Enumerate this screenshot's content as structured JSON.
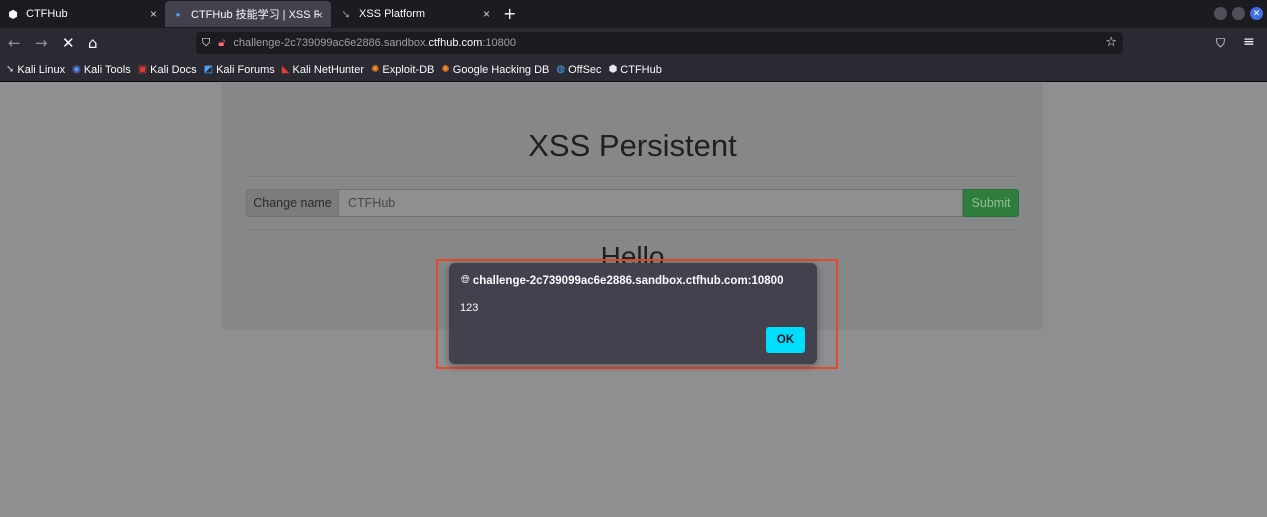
{
  "tabs": [
    {
      "title": "CTFHub",
      "icon": "ctfhub-icon",
      "close": "×"
    },
    {
      "title": "CTFHub 技能学习 | XSS Pe",
      "icon": "loading-icon",
      "close": "×"
    },
    {
      "title": "XSS Platform",
      "icon": "kali-icon",
      "close": "×"
    }
  ],
  "new_tab": "+",
  "nav": {
    "back": "←",
    "forward": "→",
    "stop": "✕",
    "home": "⌂",
    "url_prefix": "challenge-2c739099ac6e2886.sandbox.",
    "url_host": "ctfhub.com",
    "url_suffix": ":10800"
  },
  "bookmarks": [
    {
      "label": "Kali Linux",
      "glyph": "➘",
      "color": "#cfcfd8"
    },
    {
      "label": "Kali Tools",
      "glyph": "◉",
      "color": "#5a8fff"
    },
    {
      "label": "Kali Docs",
      "glyph": "▣",
      "color": "#e53935"
    },
    {
      "label": "Kali Forums",
      "glyph": "◩",
      "color": "#4aa3ff"
    },
    {
      "label": "Kali NetHunter",
      "glyph": "◣",
      "color": "#e53935"
    },
    {
      "label": "Exploit-DB",
      "glyph": "✺",
      "color": "#ff8a2a"
    },
    {
      "label": "Google Hacking DB",
      "glyph": "✺",
      "color": "#ff8a2a"
    },
    {
      "label": "OffSec",
      "glyph": "◍",
      "color": "#4aa3ff"
    },
    {
      "label": "CTFHub",
      "glyph": "⬢",
      "color": "#e8e8ee"
    }
  ],
  "page": {
    "title": "XSS Persistent",
    "addon_label": "Change name",
    "input_value": "CTFHub",
    "submit_label": "Submit",
    "hello": "Hello"
  },
  "dialog": {
    "origin": "challenge-2c739099ac6e2886.sandbox.ctfhub.com:10800",
    "message": "123",
    "ok_label": "OK"
  },
  "colors": {
    "accent": "#00ddff",
    "highlight": "#e8482a",
    "submit": "#2f7d3c"
  }
}
